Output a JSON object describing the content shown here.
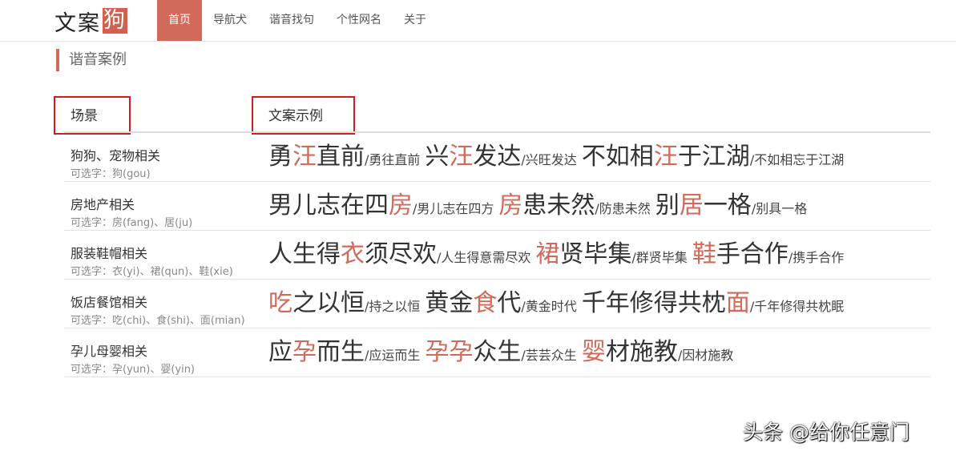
{
  "logo": {
    "main": "文案",
    "highlight": "狗"
  },
  "nav": [
    "首页",
    "导航犬",
    "谐音找句",
    "个性网名",
    "关于"
  ],
  "section_title": "谐音案例",
  "table": {
    "headers": [
      "场景",
      "文案示例"
    ],
    "rows": [
      {
        "scene": "狗狗、宠物相关",
        "options": "可选字：狗(gou)",
        "examples": [
          {
            "pre": "勇",
            "pun": "汪",
            "post": "直前",
            "orig": "/勇往直前"
          },
          {
            "pre": "兴",
            "pun": "汪",
            "post": "发达",
            "orig": "/兴旺发达"
          },
          {
            "pre": "不如相",
            "pun": "汪",
            "post": "于江湖",
            "orig": "/不如相忘于江湖"
          }
        ]
      },
      {
        "scene": "房地产相关",
        "options": "可选字：房(fang)、居(ju)",
        "examples": [
          {
            "pre": "男儿志在四",
            "pun": "房",
            "post": "",
            "orig": "/男儿志在四方"
          },
          {
            "pre": "",
            "pun": "房",
            "post": "患未然",
            "orig": "/防患未然"
          },
          {
            "pre": "别",
            "pun": "居",
            "post": "一格",
            "orig": "/别具一格"
          }
        ]
      },
      {
        "scene": "服装鞋帽相关",
        "options": "可选字：衣(yi)、裙(qun)、鞋(xie)",
        "examples": [
          {
            "pre": "人生得",
            "pun": "衣",
            "post": "须尽欢",
            "orig": "/人生得意需尽欢"
          },
          {
            "pre": "",
            "pun": "裙",
            "post": "贤毕集",
            "orig": "/群贤毕集"
          },
          {
            "pre": "",
            "pun": "鞋",
            "post": "手合作",
            "orig": "/携手合作"
          }
        ]
      },
      {
        "scene": "饭店餐馆相关",
        "options": "可选字：吃(chi)、食(shi)、面(mian)",
        "examples": [
          {
            "pre": "",
            "pun": "吃",
            "post": "之以恒",
            "orig": "/持之以恒"
          },
          {
            "pre": "黄金",
            "pun": "食",
            "post": "代",
            "orig": "/黄金时代"
          },
          {
            "pre": "千年修得共枕",
            "pun": "面",
            "post": "",
            "orig": "/千年修得共枕眠"
          }
        ]
      },
      {
        "scene": "孕儿母婴相关",
        "options": "可选字：孕(yun)、婴(yin)",
        "examples": [
          {
            "pre": "应",
            "pun": "孕",
            "post": "而生",
            "orig": "/应运而生"
          },
          {
            "pre": "",
            "pun": "孕孕",
            "post": "众生",
            "orig": "/芸芸众生"
          },
          {
            "pre": "",
            "pun": "婴",
            "post": "材施教",
            "orig": "/因材施教"
          }
        ]
      }
    ]
  },
  "watermark": "头条 @给你任意门",
  "colors": {
    "accent": "#d16a5a",
    "highlight_box": "#cc1f1f"
  }
}
